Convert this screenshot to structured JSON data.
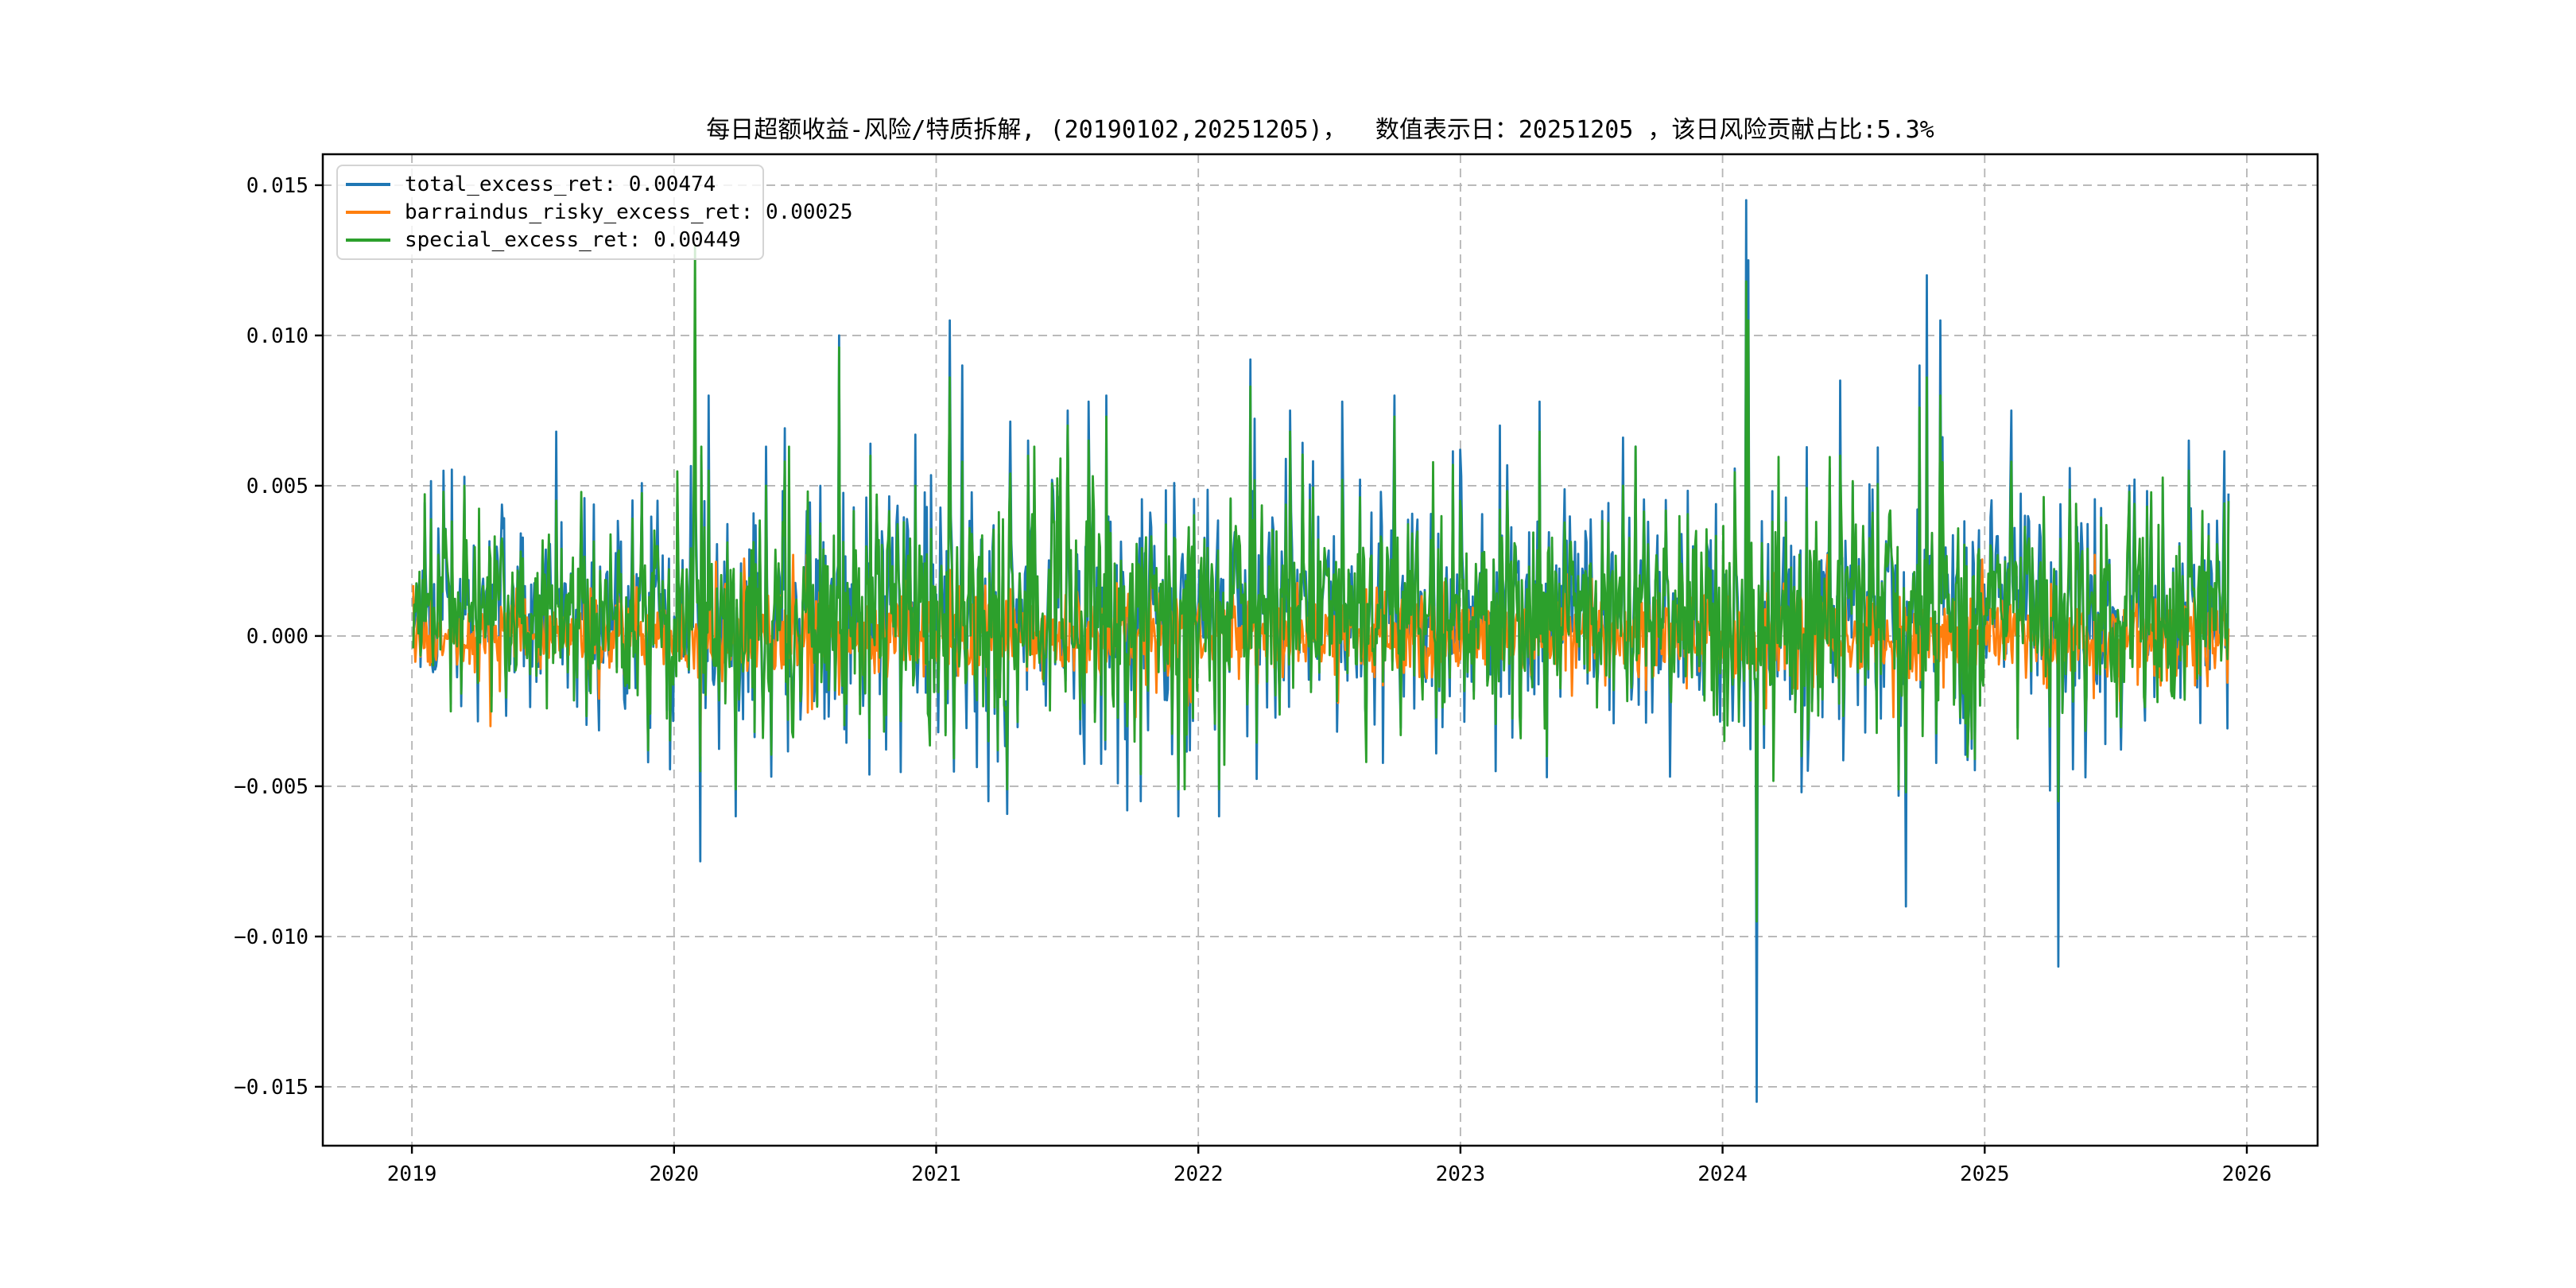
{
  "figure": {
    "background": "#ffffff"
  },
  "chart_data": {
    "type": "line",
    "title": "每日超额收益-风险/特质拆解, (20190102,20251205)，  数值表示日：20251205 ，该日风险贡献占比:5.3%",
    "date_range": [
      "20190102",
      "20251205"
    ],
    "value_display_date": "20251205",
    "risk_contribution_pct": "5.3%",
    "x_axis": {
      "lim": [
        2018.66,
        2026.27
      ],
      "ticks": [
        2019,
        2020,
        2021,
        2022,
        2023,
        2024,
        2025,
        2026
      ],
      "labels": [
        "2019",
        "2020",
        "2021",
        "2022",
        "2023",
        "2024",
        "2025",
        "2026"
      ]
    },
    "y_axis": {
      "lim": [
        -0.01696,
        0.01603
      ],
      "ticks": [
        0.015,
        0.01,
        0.005,
        0.0,
        -0.005,
        -0.01,
        -0.015
      ],
      "labels": [
        "0.015",
        "0.010",
        "0.005",
        "0.000",
        "−0.005",
        "−0.010",
        "−0.015"
      ]
    },
    "grid": {
      "on": true,
      "color": "#b5b5b5",
      "dash": "11 7"
    },
    "legend_position": "upper-left",
    "series": [
      {
        "name": "total_excess_ret",
        "key": "b",
        "color": "#1f77b4",
        "legend_label": "total_excess_ret: 0.00474",
        "last_value": 0.00474
      },
      {
        "name": "barraindus_risky_excess_ret",
        "key": "o",
        "color": "#ff7f0e",
        "legend_label": "barraindus_risky_excess_ret: 0.00025",
        "last_value": 0.00025
      },
      {
        "name": "special_excess_ret",
        "key": "g",
        "color": "#2ca02c",
        "legend_label": "special_excess_ret: 0.00449",
        "last_value": 0.00449
      }
    ],
    "synthesis": {
      "seed": 7,
      "n": 1740,
      "t0": 2019.005,
      "t1": 2025.93,
      "year_vol": [
        0.85,
        1.12,
        1.15,
        1.0,
        0.95,
        1.1,
        1.05
      ],
      "orange": {
        "mean": 5e-05,
        "std": 0.0007,
        "clamp": 0.0027,
        "burst_p": 0.06,
        "burst_mult": 1.9
      },
      "green": {
        "mean": 0.0008,
        "std": 0.0017,
        "clamp_lo": -0.0051,
        "clamp_hi": 0.0063,
        "burst_p": 0.05,
        "burst_mult": 1.6
      },
      "blue_extra_std": 0.0006,
      "blue_clamp_lo": -0.006,
      "blue_clamp_hi": 0.0075
    },
    "key_points": [
      {
        "t": 2019.12,
        "b": 0.0055,
        "g": 0.0048
      },
      {
        "t": 2019.2,
        "b": 0.0053,
        "g": 0.005
      },
      {
        "t": 2019.3,
        "o": -0.003
      },
      {
        "t": 2019.55,
        "b": 0.0068,
        "g": 0.0045
      },
      {
        "t": 2019.9,
        "b": -0.0042,
        "g": -0.0038
      },
      {
        "t": 2020.08,
        "b": 0.0054,
        "g": 0.013
      },
      {
        "t": 2020.1,
        "b": -0.0075,
        "g": -0.0045,
        "o": -0.004
      },
      {
        "t": 2020.13,
        "b": 0.008,
        "g": 0.0055
      },
      {
        "t": 2020.35,
        "b": 0.0063,
        "g": 0.005
      },
      {
        "t": 2020.63,
        "b": 0.01,
        "g": 0.0096
      },
      {
        "t": 2020.75,
        "b": 0.0064,
        "g": 0.006
      },
      {
        "t": 2020.92,
        "b": 0.0067,
        "g": 0.005
      },
      {
        "t": 2021.05,
        "b": 0.0105,
        "g": 0.0086,
        "o": 0.0022
      },
      {
        "t": 2021.1,
        "b": 0.009,
        "g": 0.0058
      },
      {
        "t": 2021.2,
        "b": -0.0055,
        "g": -0.0035
      },
      {
        "t": 2021.35,
        "b": 0.0065,
        "g": 0.006
      },
      {
        "t": 2021.5,
        "b": 0.0075,
        "g": 0.007
      },
      {
        "t": 2021.58,
        "b": 0.0078,
        "g": 0.0065
      },
      {
        "t": 2021.65,
        "b": 0.008,
        "g": 0.0073
      },
      {
        "t": 2021.73,
        "b": -0.0058,
        "g": -0.003
      },
      {
        "t": 2021.78,
        "b": -0.0055,
        "g": -0.0046
      },
      {
        "t": 2022.2,
        "b": 0.0092,
        "g": 0.0083
      },
      {
        "t": 2022.35,
        "b": 0.0075,
        "g": 0.0068
      },
      {
        "t": 2022.55,
        "b": 0.0078,
        "g": 0.0052
      },
      {
        "t": 2022.75,
        "b": 0.008,
        "g": 0.0073
      },
      {
        "t": 2023.0,
        "b": 0.0062,
        "g": 0.0045
      },
      {
        "t": 2023.15,
        "b": 0.007,
        "g": 0.0042
      },
      {
        "t": 2023.3,
        "b": 0.0078,
        "g": 0.0068,
        "o": 0.0035
      },
      {
        "t": 2023.33,
        "b": -0.0047,
        "g": -0.004
      },
      {
        "t": 2023.62,
        "b": 0.0066,
        "g": 0.005
      },
      {
        "t": 2024.09,
        "b": 0.0145,
        "g": 0.0118,
        "o": 0.003
      },
      {
        "t": 2024.1,
        "b": 0.0125,
        "g": 0.0105
      },
      {
        "t": 2024.13,
        "b": -0.0155,
        "g": -0.0095
      },
      {
        "t": 2024.3,
        "b": -0.0052,
        "g": -0.004
      },
      {
        "t": 2024.45,
        "b": 0.0085,
        "g": 0.006
      },
      {
        "t": 2024.7,
        "b": -0.009,
        "g": -0.0052
      },
      {
        "t": 2024.75,
        "b": 0.009,
        "g": 0.0076
      },
      {
        "t": 2024.78,
        "b": 0.012,
        "g": 0.0086
      },
      {
        "t": 2024.83,
        "b": 0.0105,
        "g": 0.008
      },
      {
        "t": 2025.1,
        "b": 0.0075,
        "g": 0.0058
      },
      {
        "t": 2025.28,
        "b": -0.011,
        "g": -0.0055
      },
      {
        "t": 2025.55,
        "b": 0.005,
        "g": 0.0048
      },
      {
        "t": 2025.78,
        "b": 0.0065,
        "g": 0.0055
      },
      {
        "t": 2025.93,
        "b": 0.00474,
        "g": 0.00449,
        "o": 0.00025
      }
    ]
  }
}
